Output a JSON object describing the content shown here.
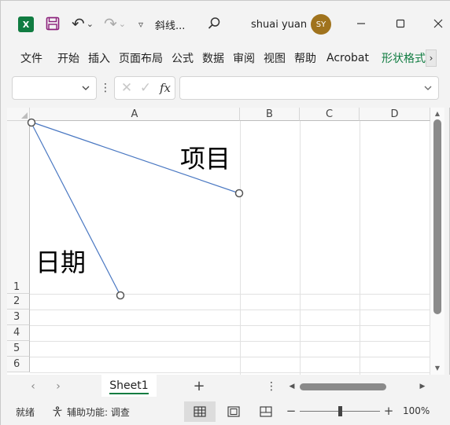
{
  "app": {
    "logo_text": "X",
    "document_title": "斜线...",
    "user_name": "shuai yuan",
    "user_initials": "SY",
    "accent_color": "#107c41"
  },
  "quick_access": {
    "undo_glyph": "↶",
    "undo_dropdown": "⌄",
    "redo_glyph": "↷",
    "redo_dropdown": "⌄",
    "more_glyph": "▿"
  },
  "ribbon": {
    "tabs": [
      {
        "label": "文件"
      },
      {
        "label": "开始"
      },
      {
        "label": "插入"
      },
      {
        "label": "页面布局"
      },
      {
        "label": "公式"
      },
      {
        "label": "数据"
      },
      {
        "label": "审阅"
      },
      {
        "label": "视图"
      },
      {
        "label": "帮助"
      },
      {
        "label": "Acrobat"
      },
      {
        "label": "形状格式",
        "active": true
      }
    ],
    "scroll_glyph": "›"
  },
  "formula_bar": {
    "name_box_value": "",
    "more_glyph": "⋮",
    "cancel_glyph": "✕",
    "enter_glyph": "✓",
    "fx_label": "fx",
    "formula_value": ""
  },
  "grid": {
    "columns": [
      "A",
      "B",
      "C",
      "D"
    ],
    "rows": [
      "1",
      "2",
      "3",
      "4",
      "5",
      "6"
    ]
  },
  "shapes": {
    "label_top": "项目",
    "label_bottom": "日期",
    "line_color": "#4a78c2"
  },
  "sheets": {
    "tabs": [
      {
        "label": "Sheet1",
        "active": true
      }
    ],
    "prev_glyph": "‹",
    "next_glyph": "›",
    "add_glyph": "+",
    "more_glyph": "⋮"
  },
  "status": {
    "ready": "就绪",
    "accessibility": "辅助功能: 调查",
    "zoom_minus": "−",
    "zoom_plus": "+",
    "zoom_level": "100%",
    "zoom_fraction": 0.5
  }
}
